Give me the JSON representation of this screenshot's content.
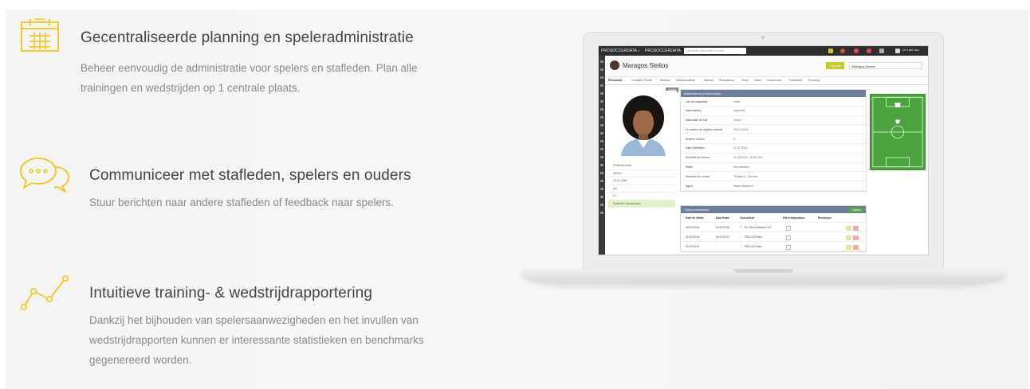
{
  "features": [
    {
      "title": "Gecentraliseerde planning en speleradministratie",
      "lines": [
        "Beheer eenvoudig de administratie voor spelers en stafleden. Plan alle",
        "trainingen en wedstrijden op 1 centrale plaats."
      ],
      "icon": "calendar-icon"
    },
    {
      "title": "Communiceer met stafleden, spelers en ouders",
      "lines": [
        "Stuur berichten naar andere stafleden of feedback naar spelers."
      ],
      "icon": "chat-bubbles-icon"
    },
    {
      "title": "Intuitieve training- & wedstrijdrapportering",
      "lines": [
        "Dankzij het bijhouden van spelersaanwezigheden en het invullen van",
        "wedstrijdrapporten kunnen er interessante statistieken en benchmarks",
        "gegenereerd worden."
      ],
      "icon": "line-chart-icon"
    }
  ],
  "colors": {
    "accent": "#f5c518",
    "title": "#444444",
    "desc": "#8a8a8a"
  },
  "app": {
    "brand": "PROSOCCERDATA",
    "brand2": "PROSOCCERDATA",
    "search_placeholder": "Chercher personne ou club...",
    "user": "De Laet Jan",
    "player_name": "Maragos Stelios",
    "add_button": "+ Ajouter",
    "player_select": "Maragos Stelios",
    "tabs": [
      "Personnel",
      "Contact & École",
      "Médical",
      "Entraînements",
      "Matchs",
      "Évaluations",
      "Suivi",
      "Vidéo",
      "Documents",
      "Feedback",
      "Scouting"
    ],
    "photo_button": "Ajouter",
    "left_info": [
      "Professie Data",
      "4 Men",
      "24-11-1984",
      "pm",
      "VJ",
      "Scheme 4 temps plein"
    ],
    "personal": {
      "header": "Informations personnelles",
      "rows": [
        {
          "k": "Lieu de naissance",
          "v": "Verra"
        },
        {
          "k": "Nationalité(s)",
          "v": "Argentine"
        },
        {
          "k": "Nationalité de foot",
          "v": "Grèce"
        },
        {
          "k": "Le numéro de registre national",
          "v": "9041704913"
        },
        {
          "k": "Numéro d'union",
          "v": "5"
        },
        {
          "k": "Date d'affiliation",
          "v": "01-07-2013"
        },
        {
          "k": "Données de licence",
          "v": "01-08-2013 - 29-06-2017"
        },
        {
          "k": "Statut",
          "v": "Non-amateur"
        },
        {
          "k": "Données de contrat",
          "v": "Terminé à - Opsorte -"
        },
        {
          "k": "Agent",
          "v": "Klaver Maarten2"
        }
      ]
    },
    "clubs": {
      "header": "Clubs précédents",
      "add": "+ Ajouter",
      "columns": [
        "Date de début",
        "Date finale",
        "Club actuel",
        "Mis à disposition",
        "Remarque"
      ],
      "rows": [
        {
          "start": "29/07/2015",
          "end": "01/07/2015",
          "club": "FC Groot Dilbeek U17"
        },
        {
          "start": "01/07/2015",
          "end": "01/07/2017",
          "club": "PSD U19 Men"
        },
        {
          "start": "01/07/2017",
          "end": "-",
          "club": "PSD U21 Men"
        }
      ]
    }
  }
}
